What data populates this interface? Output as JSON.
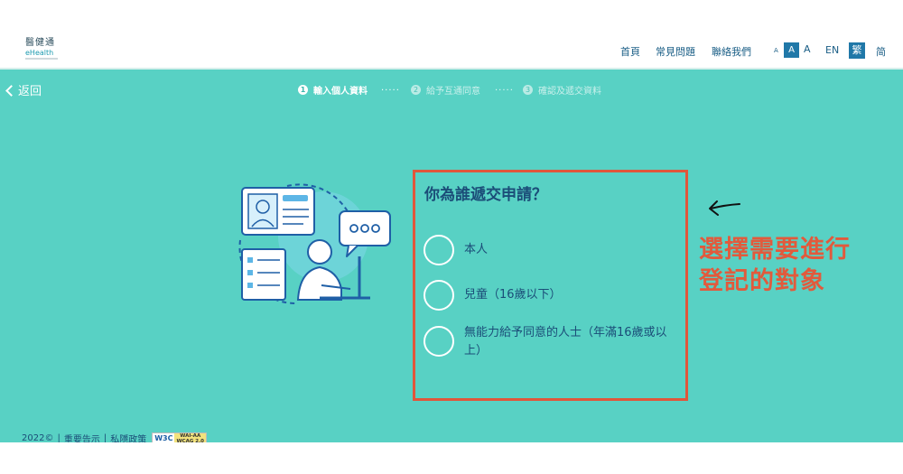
{
  "header": {
    "logo_cn": "醫健通",
    "logo_en": "eHealth",
    "nav": [
      "首頁",
      "常見問題",
      "聯絡我們"
    ],
    "font_size_labels": [
      "A",
      "A",
      "A"
    ],
    "languages": [
      "EN",
      "繁",
      "简"
    ]
  },
  "back_label": "返回",
  "steps": [
    {
      "num": "1",
      "label": "輸入個人資料",
      "active": true
    },
    {
      "num": "2",
      "label": "給予互通同意",
      "active": false
    },
    {
      "num": "3",
      "label": "確認及遞交資料",
      "active": false
    }
  ],
  "step_dots": ".....",
  "form": {
    "question": "你為誰遞交申請？",
    "options": [
      {
        "label": "本人"
      },
      {
        "label": "兒童（16歲以下）"
      },
      {
        "label": "無能力給予同意的人士（年滿16歲或以上）"
      }
    ]
  },
  "annotation": {
    "line1": "選擇需要進行",
    "line2": "登記的對象",
    "color": "#e25a3c"
  },
  "footer": {
    "copyright": "2022©",
    "notice": "重要告示",
    "privacy": "私隱政策",
    "badge_w3c": "W3C",
    "badge_wcag_line1": "WAI-AA",
    "badge_wcag_line2": "WCAG 2.0"
  },
  "colors": {
    "background": "#58d1c4",
    "accent": "#2078a8",
    "text_dark": "#1b4d78"
  },
  "icons": [
    "chevron-left-icon",
    "user-profile-illustration"
  ]
}
